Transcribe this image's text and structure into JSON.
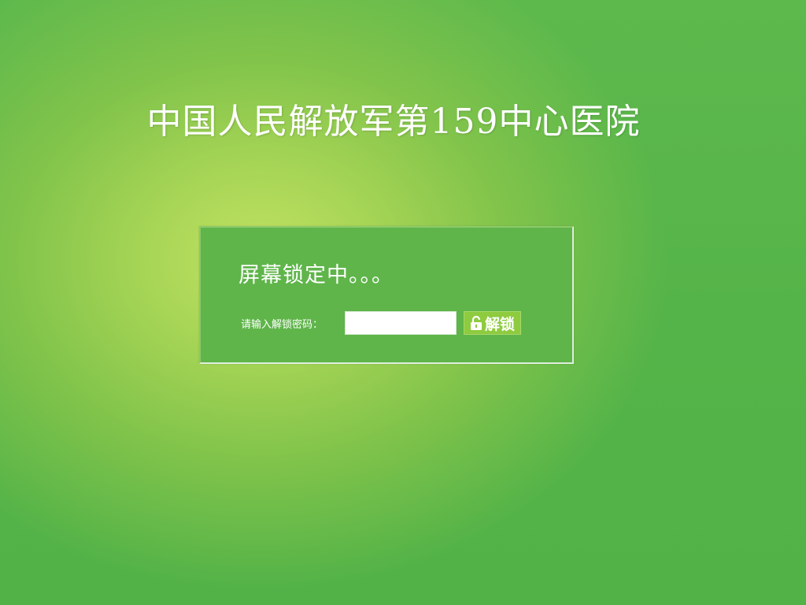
{
  "page": {
    "title": "中国人民解放军第159中心医院"
  },
  "lock_panel": {
    "heading": "屏幕锁定中。。。",
    "password_label": "请输入解锁密码：",
    "password_value": "",
    "password_placeholder": "",
    "unlock_button": {
      "label": "解锁",
      "icon": "unlock-icon"
    }
  },
  "colors": {
    "background": "#55b449",
    "panel": "#5fb54a",
    "button": "#8ecb3f",
    "text": "#ffffff"
  }
}
